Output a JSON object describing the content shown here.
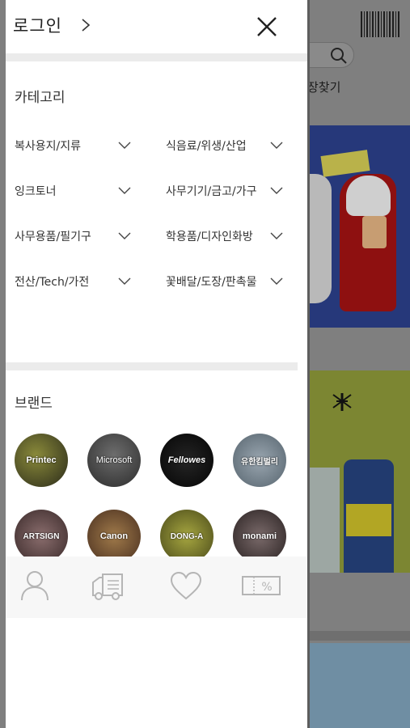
{
  "background_page": {
    "store_locator_label": "장찾기"
  },
  "drawer": {
    "login_label": "로그인",
    "category_title": "카테고리",
    "categories": [
      {
        "label": "복사용지/지류"
      },
      {
        "label": "식음료/위생/산업"
      },
      {
        "label": "잉크토너"
      },
      {
        "label": "사무기기/금고/가구"
      },
      {
        "label": "사무용품/필기구"
      },
      {
        "label": "학용품/디자인화방"
      },
      {
        "label": "전산/Tech/가전"
      },
      {
        "label": "꽃배달/도장/판촉물"
      }
    ],
    "brand_title": "브랜드",
    "brands": [
      {
        "name": "Printec",
        "color": "#6b6b2a"
      },
      {
        "name": "Microsoft",
        "color": "#4a4a4a"
      },
      {
        "name": "Fellowes",
        "color": "#0b0b0b"
      },
      {
        "name": "유한킴벌리",
        "color": "#7a8a96"
      },
      {
        "name": "ARTSIGN",
        "color": "#6a5a5a"
      },
      {
        "name": "Canon",
        "color": "#7a5a3a"
      },
      {
        "name": "DONG-A",
        "color": "#8a8a2a"
      },
      {
        "name": "monami",
        "color": "#5a4a4a"
      }
    ],
    "bottom_icons": [
      "user-icon",
      "delivery-truck-icon",
      "heart-icon",
      "coupon-icon"
    ]
  },
  "colors": {
    "overlay": "#7f7f7f",
    "divider": "#ebebeb",
    "icon_gray": "#b5b5b5"
  }
}
